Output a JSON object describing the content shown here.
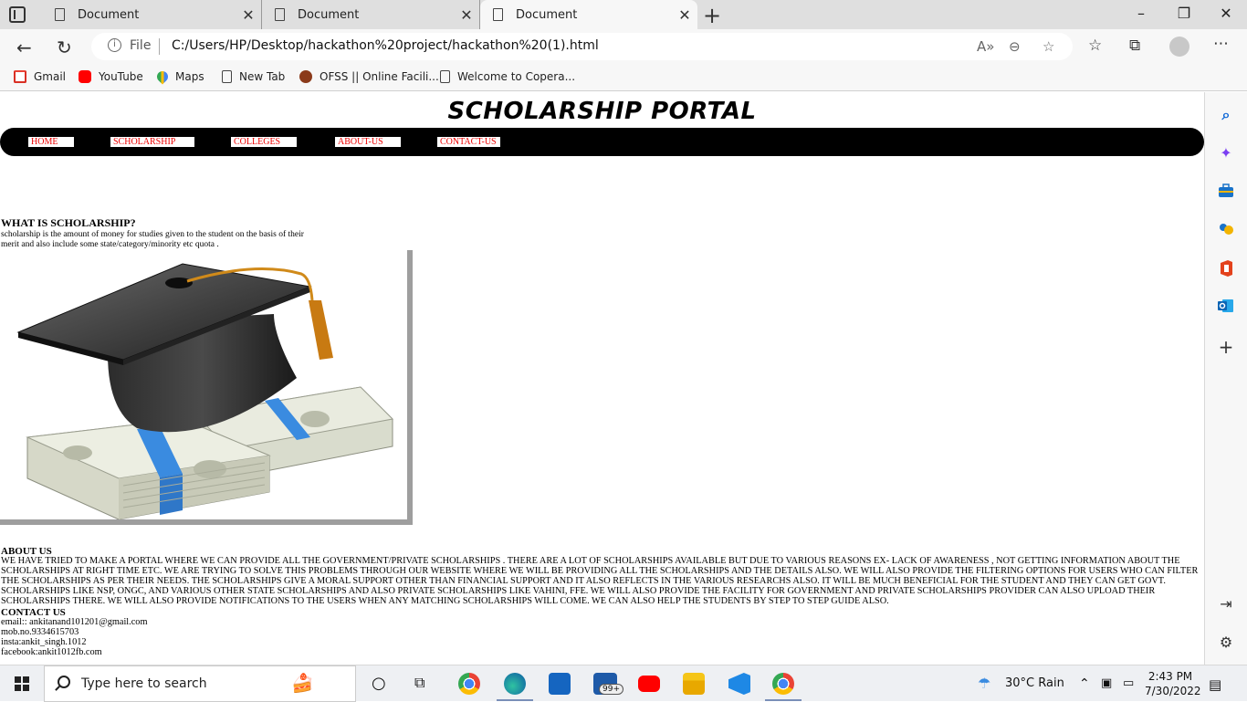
{
  "browser": {
    "tabs": [
      {
        "title": "Document",
        "active": false
      },
      {
        "title": "Document",
        "active": false
      },
      {
        "title": "Document",
        "active": true
      }
    ],
    "url_scheme_label": "File",
    "url": "C:/Users/HP/Desktop/hackathon%20project/hackathon%20(1).html",
    "favorites": [
      {
        "label": "Gmail",
        "icon": "gmail-icon"
      },
      {
        "label": "YouTube",
        "icon": "youtube-icon"
      },
      {
        "label": "Maps",
        "icon": "maps-icon"
      },
      {
        "label": "New Tab",
        "icon": "document-icon"
      },
      {
        "label": "OFSS || Online Facili...",
        "icon": "ofss-icon"
      },
      {
        "label": "Welcome to Copera...",
        "icon": "document-icon"
      }
    ]
  },
  "page": {
    "site_title": "SCHOLARSHIP PORTAL",
    "nav": [
      "HOME",
      "SCHOLARSHIP",
      "COLLEGES",
      "ABOUT-US",
      "CONTACT-US"
    ],
    "what_is": {
      "title": "WHAT IS SCHOLARSHIP?",
      "text": "scholarship is the amount of money for studies given to the student on the basis of their merit and also include some state/category/minority etc quota ."
    },
    "about": {
      "title": "ABOUT US",
      "text": "WE HAVE TRIED TO MAKE A PORTAL WHERE WE CAN PROVIDE ALL THE GOVERNMENT/PRIVATE SCHOLARSHIPS . THERE ARE A LOT OF SCHOLARSHIPS AVAILABLE BUT DUE TO VARIOUS REASONS EX- LACK OF AWARENESS , NOT GETTING INFORMATION ABOUT THE SCHOLARSHIPS AT RIGHT TIME ETC. WE ARE TRYING TO SOLVE THIS PROBLEMS THROUGH OUR WEBSITE WHERE WE WILL BE PROVIDING ALL THE SCHOLARSHIPS AND THE DETAILS ALSO. WE WILL ALSO PROVIDE THE FILTERING OPTIONS FOR USERS WHO CAN FILTER THE SCHOLARSHIPS AS PER THEIR NEEDS. THE SCHOLARSHIPS GIVE A MORAL SUPPORT OTHER THAN FINANCIAL SUPPORT AND IT ALSO REFLECTS IN THE VARIOUS RESEARCHS ALSO. IT WILL BE MUCH BENEFICIAL FOR THE STUDENT AND THEY CAN GET GOVT. SCHOLARSHIPS LIKE NSP, ONGC, AND VARIOUS OTHER STATE SCHOLARSHIPS AND ALSO PRIVATE SCHOLARSHIPS LIKE VAHINI, FFE. WE WILL ALSO PROVIDE THE FACILITY FOR GOVERNMENT AND PRIVATE SCHOLARSHIPS PROVIDER CAN ALSO UPLOAD THEIR SCHOLARSHIPS THERE. WE WILL ALSO PROVIDE NOTIFICATIONS TO THE USERS WHEN ANY MATCHING SCHOLARSHIPS WILL COME. WE CAN ALSO HELP THE STUDENTS BY STEP TO STEP GUIDE ALSO."
    },
    "contact": {
      "title": "CONTACT US",
      "lines": [
        "email:: ankitanand101201@gmail.com",
        "mob.no.9334615703",
        "insta:ankit_singh.1012",
        "facebook:ankit1012fb.com"
      ]
    }
  },
  "taskbar": {
    "search_placeholder": "Type here to search",
    "mail_badge": "99+",
    "weather": "30°C  Rain",
    "time": "2:43 PM",
    "date": "7/30/2022"
  },
  "colors": {
    "nav_link_text": "#e00000",
    "navbar_bg": "#000000",
    "image_border": "#9e9e9e"
  }
}
